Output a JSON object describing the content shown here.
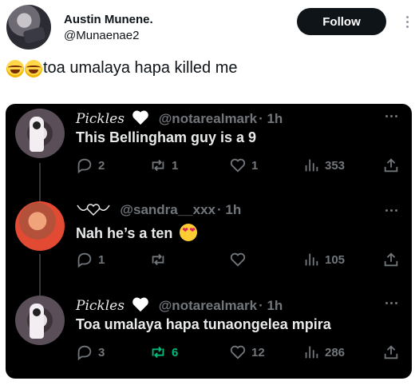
{
  "outer": {
    "name": "Austin Munene.",
    "handle": "@Munaenae2",
    "follow_label": "Follow",
    "text": "toa umalaya hapa killed me"
  },
  "thread": [
    {
      "name": "Pickles",
      "handle": "@notarealmark",
      "time": "· 1h",
      "body": "This Bellingham guy is a 9",
      "replies": "2",
      "retweets": "1",
      "likes": "1",
      "views": "353"
    },
    {
      "name": "",
      "handle": "@sandra__xxx",
      "time": "· 1h",
      "body": "Nah he’s a ten",
      "replies": "1",
      "retweets": "",
      "likes": "",
      "views": "105"
    },
    {
      "name": "Pickles",
      "handle": "@notarealmark",
      "time": "· 1h",
      "body": "Toa umalaya hapa tunaongelea mpira",
      "replies": "3",
      "retweets": "6",
      "likes": "12",
      "views": "286"
    }
  ],
  "colors": {
    "retweet_active": "#00ba7c",
    "muted": "#71767b",
    "follow_bg": "#0f1419"
  }
}
